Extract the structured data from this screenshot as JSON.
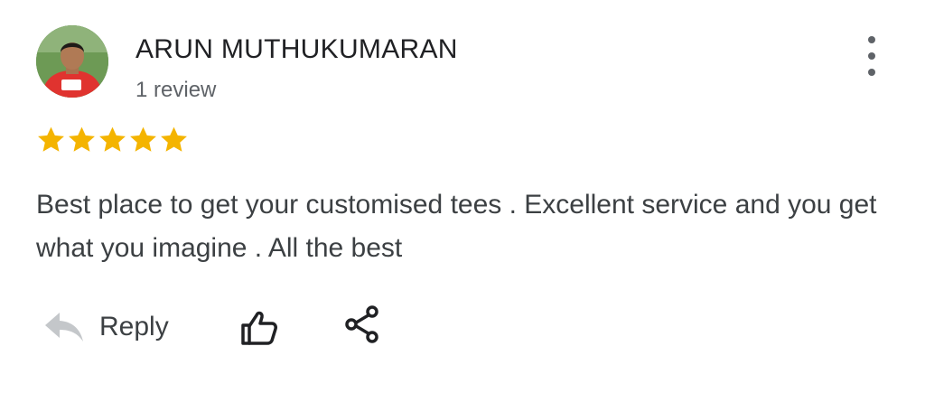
{
  "review": {
    "author_name": "ARUN MUTHUKUMARAN",
    "review_count": "1 review",
    "rating": 5,
    "rating_max": 5,
    "text": "Best place to get your customised tees . Excellent service and you get what you imagine . All the best"
  },
  "actions": {
    "reply_label": "Reply"
  },
  "icons": {
    "more": "more-vert-icon",
    "reply": "reply-icon",
    "like": "thumbs-up-icon",
    "share": "share-icon"
  },
  "colors": {
    "star": "#F4B400",
    "name": "#202124",
    "secondary": "#5F6368",
    "body_text": "#3C4043",
    "reply_icon": "#C4C7CA"
  }
}
